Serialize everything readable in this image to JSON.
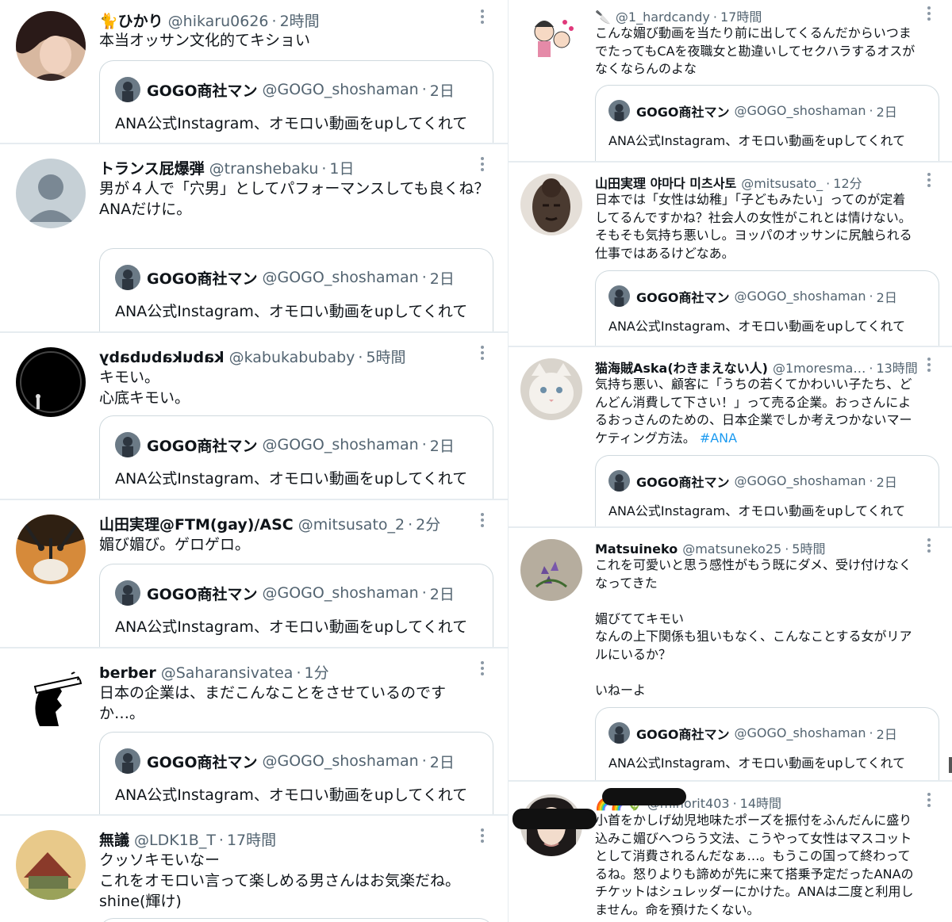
{
  "colors": {
    "accent": "#1d9bf0",
    "secondary_text": "#536471",
    "border": "#e6ecf0"
  },
  "quoted_tweet": {
    "name": "GOGO商社マン",
    "handle": "@GOGO_shoshaman",
    "time": "2日",
    "text": "ANA公式Instagram、オモロい動画をupしてくれて"
  },
  "left_tweets": [
    {
      "name": "🐈ひかり",
      "handle": "@hikaru0626",
      "time": "2時間",
      "text": "本当オッサン文化的てキショい"
    },
    {
      "name": "トランス屁爆弾",
      "handle": "@transhebaku",
      "time": "1日",
      "text": "男が４人で「穴男」としてパフォーマンスしても良くね？\nANAだけに。"
    },
    {
      "name": "kabukabubaby",
      "handle": "@kabukabubaby",
      "time": "5時間",
      "text": "キモい。\n心底キモい。"
    },
    {
      "name": "山田実理@FTM(gay)/ASC",
      "handle": "@mitsusato_2",
      "time": "2分",
      "text": "媚び媚び。ゲロゲロ。"
    },
    {
      "name": "berber",
      "handle": "@Saharansivatea",
      "time": "1分",
      "text": "日本の企業は、まだこんなことをさせているのです\nか…。"
    },
    {
      "name": "無議",
      "handle": "@LDK1B_T",
      "time": "17時間",
      "text": "クッソキモいなー\nこれをオモロい言って楽しめる男さんはお気楽だね。\nshine(輝け)"
    }
  ],
  "right_tweets": [
    {
      "name": "🔪",
      "handle": "@1_hardcandy",
      "time": "17時間",
      "text": "こんな媚び動画を当たり前に出してくるんだからいつま\nでたってもCAを夜職女と勘違いしてセクハラするオスが\nなくならんのよな"
    },
    {
      "name": "山田実理 야마다 미츠사토",
      "handle": "@mitsusato_",
      "time": "12分",
      "text": "日本では「女性は幼稚」「子どもみたい」ってのが定着\nしてるんですかね？社会人の女性がこれとは情けない。\nそもそも気持ち悪いし。ヨッパのオッサンに尻触られる\n仕事ではあるけどなあ。"
    },
    {
      "name": "猫海賊Aska(わきまえない人)",
      "handle": "@1moresma…",
      "time": "13時間",
      "text": "気持ち悪い、顧客に「うちの若くてかわいい子たち、ど\nんどん消費して下さい！」って売る企業。おっさんによ\nるおっさんのための、日本企業でしか考えつかないマー\nケティング方法。",
      "hashtag": "#ANA"
    },
    {
      "name": "Matsuineko",
      "handle": "@matsuneko25",
      "time": "5時間",
      "text": "これを可愛いと思う感性がもう既にダメ、受け付けなく\nなってきた\n\n媚びててキモい\nなんの上下関係も狙いもなく、こんなことする女がリア\nルにいるか？\n\nいねーよ"
    },
    {
      "name": "🌈🌈🌷",
      "handle": "@minorit403",
      "time": "14時間",
      "text": "小首をかしげ幼児地味たポーズを振付をふんだんに盛り\n込みこ媚びへつらう文法、こうやって女性はマスコット\nとして消費されるんだなぁ…。もうこの国って終わって\nるね。怒りよりも諦めが先に来て搭乗予定だったANAの\nチケットはシュレッダーにかけた。ANAは二度と利用し\nません。命を預けたくない。"
    }
  ]
}
